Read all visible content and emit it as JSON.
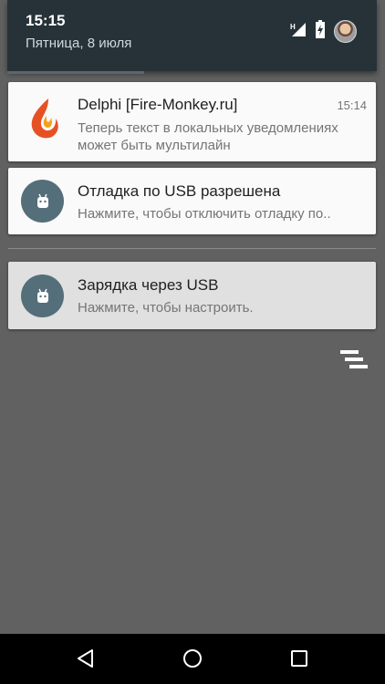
{
  "status_header": {
    "time": "15:15",
    "date": "Пятница, 8 июля",
    "icons": [
      "signal-h-icon",
      "battery-charging-icon",
      "user-avatar"
    ]
  },
  "notifications": [
    {
      "app_icon": "delphi-firemonkey-icon",
      "title": "Delphi [Fire-Monkey.ru]",
      "time": "15:14",
      "body_lines": [
        "Теперь текст в локальных уведомлениях",
        "может быть мультилайн"
      ]
    },
    {
      "app_icon": "android-usb-icon",
      "title": "Отладка по USB разрешена",
      "body": "Нажмите, чтобы отключить отладку по.."
    },
    {
      "app_icon": "android-usb-icon",
      "title": "Зарядка через USB",
      "body": "Нажмите, чтобы настроить."
    }
  ],
  "actions": {
    "dismiss_all_icon": "clear-all-icon"
  },
  "navbar": {
    "icons": [
      "back-icon",
      "home-icon",
      "recents-icon"
    ]
  },
  "colors": {
    "shade_background": "#616161",
    "header_background": "#263238",
    "icon_circle": "#546e7a",
    "card_background": "#fafafa",
    "ongoing_card_background": "#e0e0e0"
  }
}
